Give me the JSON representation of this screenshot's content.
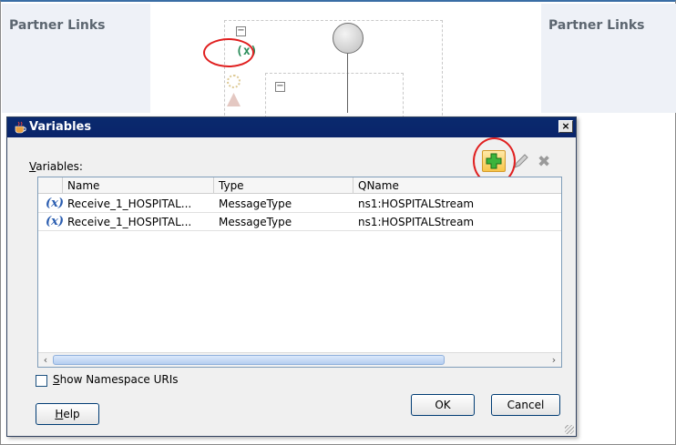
{
  "canvas": {
    "partner_links_left": "Partner Links",
    "partner_links_right": "Partner Links",
    "variables_icon": "(x)",
    "colors": {
      "accent_red": "#e02020",
      "title_blue": "#0a246a"
    }
  },
  "dialog": {
    "title": "Variables",
    "close_label": "×",
    "variables_label": "Variables:",
    "table": {
      "headers": [
        "Name",
        "Type",
        "QName"
      ],
      "rows": [
        {
          "icon": "(x)",
          "name": "Receive_1_HOSPITAL...",
          "type": "MessageType",
          "qname": "ns1:HOSPITALStream"
        },
        {
          "icon": "(x)",
          "name": "Receive_1_HOSPITAL...",
          "type": "MessageType",
          "qname": "ns1:HOSPITALStream"
        }
      ]
    },
    "show_namespace_label": "Show Namespace URIs",
    "help_label": "Help",
    "ok_label": "OK",
    "cancel_label": "Cancel",
    "icons": [
      "add-icon",
      "edit-icon",
      "delete-icon"
    ]
  }
}
